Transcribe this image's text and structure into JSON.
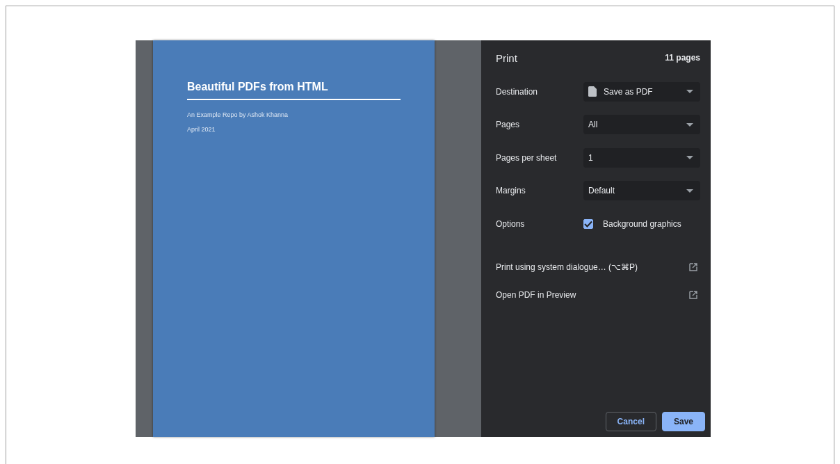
{
  "preview": {
    "title": "Beautiful PDFs from HTML",
    "subtitle": "An Example Repo by Ashok Khanna",
    "date": "April 2021"
  },
  "panel": {
    "title": "Print",
    "page_count": "11 pages"
  },
  "settings": [
    {
      "kind": "select",
      "label": "Destination",
      "value": "Save as PDF",
      "file_icon": true
    },
    {
      "kind": "select",
      "label": "Pages",
      "value": "All",
      "file_icon": false
    },
    {
      "kind": "select",
      "label": "Pages per sheet",
      "value": "1",
      "file_icon": false
    },
    {
      "kind": "select",
      "label": "Margins",
      "value": "Default",
      "file_icon": false
    },
    {
      "kind": "checkbox",
      "label": "Options",
      "value": "Background graphics",
      "checked": true
    }
  ],
  "links": [
    "Print using system dialogue… (⌥⌘P)",
    "Open PDF in Preview"
  ],
  "buttons": [
    {
      "label": "Cancel",
      "primary": false
    },
    {
      "label": "Save",
      "primary": true
    }
  ]
}
